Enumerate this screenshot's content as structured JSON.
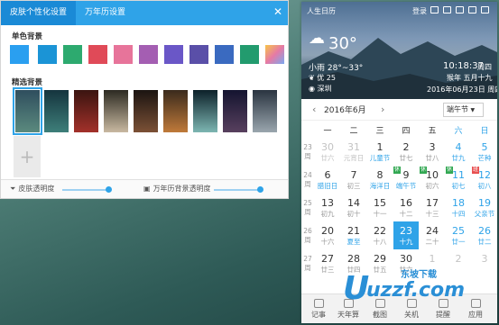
{
  "skin_panel": {
    "tabs": [
      "皮肤个性化设置",
      "万年历设置"
    ],
    "solid_title": "单色背景",
    "solid_colors": [
      "#2a9ff0",
      "#1b94d6",
      "#2daa6f",
      "#e04a58",
      "#e7749a",
      "#a45eb2",
      "#6a57c7",
      "#5a4fa8",
      "#3a6ac0",
      "#229b6e",
      "#f4b53c"
    ],
    "solid_last_gradient": [
      "#f7c548",
      "#e67aa5",
      "#7aa8f0"
    ],
    "wallpaper_title": "精选背景",
    "wallpapers": [
      {
        "colors": [
          "#2f4e5e",
          "#5b8a7e"
        ]
      },
      {
        "colors": [
          "#15343e",
          "#3e7f7a"
        ]
      },
      {
        "colors": [
          "#3a1410",
          "#a3312a"
        ]
      },
      {
        "colors": [
          "#2c2a22",
          "#c9b9a1"
        ]
      },
      {
        "colors": [
          "#1b1411",
          "#7c5136"
        ]
      },
      {
        "colors": [
          "#3a2a1c",
          "#c07a3a"
        ]
      },
      {
        "colors": [
          "#0c2029",
          "#7db6b2"
        ]
      },
      {
        "colors": [
          "#141430",
          "#58405e"
        ]
      },
      {
        "colors": [
          "#2a3440",
          "#9aa6ae"
        ]
      }
    ],
    "skin_opacity_label": "皮肤透明度",
    "calendar_opacity_label": "万年历背景透明度"
  },
  "calendar": {
    "header_title": "人生日历",
    "login": "登录",
    "temperature": "30°",
    "weather": "小雨 28°~33°",
    "air": "优 25",
    "city": "深圳",
    "time": "10:18:37",
    "weekday": "周四",
    "lunar_year": "猴年 五月十九",
    "date_full": "2016年06月23日 周四",
    "month_label": "2016年6月",
    "holiday_select": "端午节",
    "weekdays": [
      "一",
      "二",
      "三",
      "四",
      "五",
      "六",
      "日"
    ],
    "weeks": [
      {
        "num": [
          "23",
          "周"
        ],
        "days": [
          {
            "d": "30",
            "l": "廿六",
            "t": "off"
          },
          {
            "d": "31",
            "l": "元宵日",
            "t": "off"
          },
          {
            "d": "1",
            "l": "儿童节",
            "t": "hol"
          },
          {
            "d": "2",
            "l": "廿七",
            "t": ""
          },
          {
            "d": "3",
            "l": "廿八",
            "t": ""
          },
          {
            "d": "4",
            "l": "廿九",
            "t": "we"
          },
          {
            "d": "5",
            "l": "芒种",
            "t": "we"
          }
        ]
      },
      {
        "num": [
          "24",
          "周"
        ],
        "days": [
          {
            "d": "6",
            "l": "腊旧日",
            "t": "hol"
          },
          {
            "d": "7",
            "l": "初三",
            "t": ""
          },
          {
            "d": "8",
            "l": "海洋日",
            "t": "hol"
          },
          {
            "d": "9",
            "l": "端午节",
            "t": "hol",
            "b": "休"
          },
          {
            "d": "10",
            "l": "初六",
            "t": "",
            "b": "休"
          },
          {
            "d": "11",
            "l": "初七",
            "t": "we",
            "b": "休"
          },
          {
            "d": "12",
            "l": "初八",
            "t": "we",
            "x": "班"
          }
        ]
      },
      {
        "num": [
          "25",
          "周"
        ],
        "days": [
          {
            "d": "13",
            "l": "初九",
            "t": ""
          },
          {
            "d": "14",
            "l": "初十",
            "t": ""
          },
          {
            "d": "15",
            "l": "十一",
            "t": ""
          },
          {
            "d": "16",
            "l": "十二",
            "t": ""
          },
          {
            "d": "17",
            "l": "十三",
            "t": ""
          },
          {
            "d": "18",
            "l": "十四",
            "t": "we"
          },
          {
            "d": "19",
            "l": "父亲节",
            "t": "we hol"
          }
        ]
      },
      {
        "num": [
          "26",
          "周"
        ],
        "days": [
          {
            "d": "20",
            "l": "十六",
            "t": ""
          },
          {
            "d": "21",
            "l": "夏至",
            "t": "hol"
          },
          {
            "d": "22",
            "l": "十八",
            "t": ""
          },
          {
            "d": "23",
            "l": "十九",
            "t": "today"
          },
          {
            "d": "24",
            "l": "二十",
            "t": ""
          },
          {
            "d": "25",
            "l": "廿一",
            "t": "we"
          },
          {
            "d": "26",
            "l": "廿二",
            "t": "we"
          }
        ]
      },
      {
        "num": [
          "27",
          "周"
        ],
        "days": [
          {
            "d": "27",
            "l": "廿三",
            "t": ""
          },
          {
            "d": "28",
            "l": "廿四",
            "t": ""
          },
          {
            "d": "29",
            "l": "廿五",
            "t": ""
          },
          {
            "d": "30",
            "l": "廿六",
            "t": ""
          },
          {
            "d": "1",
            "l": "",
            "t": "off"
          },
          {
            "d": "2",
            "l": "",
            "t": "off"
          },
          {
            "d": "3",
            "l": "",
            "t": "off"
          }
        ]
      }
    ],
    "bottom": [
      "记事",
      "天年算",
      "截图",
      "关机",
      "提醒",
      "应用"
    ]
  },
  "watermark": {
    "cn": "东坡下载",
    "en": "uzzf.com"
  },
  "colors": {
    "accent": "#2fa3e8",
    "today_bg": "#2fa3e8"
  }
}
